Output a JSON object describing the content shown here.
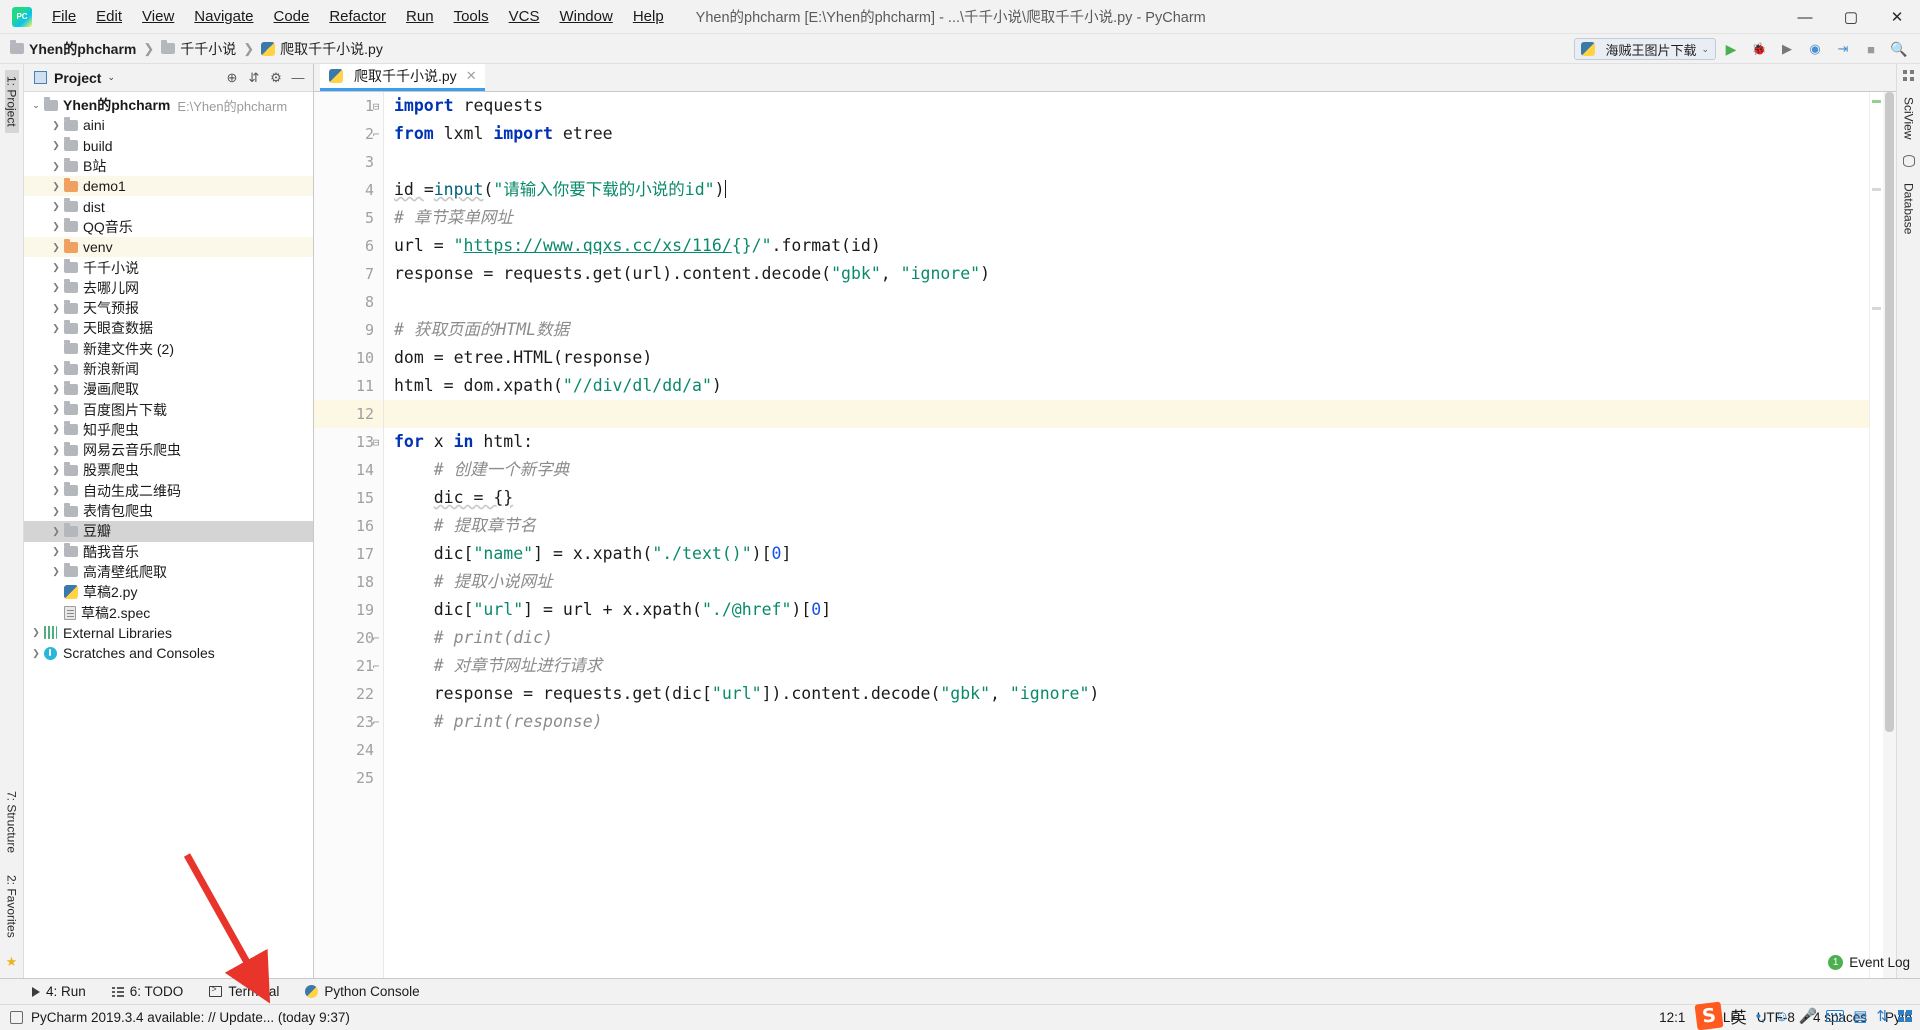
{
  "window": {
    "title": "Yhen的phcharm [E:\\Yhen的phcharm] - ...\\千千小说\\爬取千千小说.py - PyCharm",
    "minimize": "—",
    "maximize": "▢",
    "close": "✕",
    "logo_text": "PC"
  },
  "menu": [
    {
      "label": "File"
    },
    {
      "label": "Edit"
    },
    {
      "label": "View"
    },
    {
      "label": "Navigate"
    },
    {
      "label": "Code"
    },
    {
      "label": "Refactor"
    },
    {
      "label": "Run"
    },
    {
      "label": "Tools"
    },
    {
      "label": "VCS"
    },
    {
      "label": "Window"
    },
    {
      "label": "Help"
    }
  ],
  "breadcrumb": {
    "items": [
      {
        "label": "Yhen的phcharm",
        "icon": "folder-icon",
        "bold": true
      },
      {
        "label": "千千小说",
        "icon": "folder-icon",
        "bold": false
      },
      {
        "label": "爬取千千小说.py",
        "icon": "python-file-icon",
        "bold": false
      }
    ],
    "separator": "❯"
  },
  "toolbar": {
    "run_config": "海贼王图片下载",
    "run_config_caret": "⌄",
    "buttons": [
      {
        "name": "run-button",
        "glyph": "▶",
        "color": "#4caf50"
      },
      {
        "name": "debug-button",
        "glyph": "🐞",
        "color": "#4a8fd0"
      },
      {
        "name": "run-coverage-button",
        "glyph": "▶",
        "color": "#777777"
      },
      {
        "name": "profile-button",
        "glyph": "◉",
        "color": "#4a8fd0"
      },
      {
        "name": "run-with-console-button",
        "glyph": "⇥",
        "color": "#4a8fd0"
      },
      {
        "name": "stop-button",
        "glyph": "■",
        "color": "#9a9a9a"
      },
      {
        "name": "search-everywhere-icon",
        "glyph": "🔍",
        "color": "#555555"
      }
    ]
  },
  "left_rail": {
    "project_label": "1: Project",
    "structure_label": "7: Structure",
    "favorites_label": "2: Favorites"
  },
  "right_rail": {
    "sciview_label": "SciView",
    "database_label": "Database"
  },
  "project_panel": {
    "title": "Project",
    "caret": "⌄",
    "header_icons": [
      {
        "name": "locate-file-icon",
        "glyph": "⊕"
      },
      {
        "name": "collapse-all-icon",
        "glyph": "⇵"
      },
      {
        "name": "settings-gear-icon",
        "glyph": "⚙"
      },
      {
        "name": "hide-panel-icon",
        "glyph": "—"
      }
    ],
    "tree": [
      {
        "label": "Yhen的phcharm",
        "path": "E:\\Yhen的phcharm",
        "icon": "folder-icon",
        "depth": 0,
        "arrow": "open",
        "bold": true,
        "state": "none"
      },
      {
        "label": "aini",
        "icon": "folder-icon",
        "depth": 1,
        "arrow": "closed",
        "state": "none"
      },
      {
        "label": "build",
        "icon": "folder-icon",
        "depth": 1,
        "arrow": "closed",
        "state": "none"
      },
      {
        "label": "B站",
        "icon": "folder-icon",
        "depth": 1,
        "arrow": "closed",
        "state": "none"
      },
      {
        "label": "demo1",
        "icon": "folder-orange-icon",
        "depth": 1,
        "arrow": "closed",
        "state": "highlight"
      },
      {
        "label": "dist",
        "icon": "folder-icon",
        "depth": 1,
        "arrow": "closed",
        "state": "none"
      },
      {
        "label": "QQ音乐",
        "icon": "folder-icon",
        "depth": 1,
        "arrow": "closed",
        "state": "none"
      },
      {
        "label": "venv",
        "icon": "folder-orange-icon",
        "depth": 1,
        "arrow": "closed",
        "state": "highlight"
      },
      {
        "label": "千千小说",
        "icon": "folder-icon",
        "depth": 1,
        "arrow": "closed",
        "state": "none"
      },
      {
        "label": "去哪儿网",
        "icon": "folder-icon",
        "depth": 1,
        "arrow": "closed",
        "state": "none"
      },
      {
        "label": "天气预报",
        "icon": "folder-icon",
        "depth": 1,
        "arrow": "closed",
        "state": "none"
      },
      {
        "label": "天眼查数据",
        "icon": "folder-icon",
        "depth": 1,
        "arrow": "closed",
        "state": "none"
      },
      {
        "label": "新建文件夹 (2)",
        "icon": "folder-icon",
        "depth": 1,
        "arrow": "none",
        "state": "none"
      },
      {
        "label": "新浪新闻",
        "icon": "folder-icon",
        "depth": 1,
        "arrow": "closed",
        "state": "none"
      },
      {
        "label": "漫画爬取",
        "icon": "folder-icon",
        "depth": 1,
        "arrow": "closed",
        "state": "none"
      },
      {
        "label": "百度图片下载",
        "icon": "folder-icon",
        "depth": 1,
        "arrow": "closed",
        "state": "none"
      },
      {
        "label": "知乎爬虫",
        "icon": "folder-icon",
        "depth": 1,
        "arrow": "closed",
        "state": "none"
      },
      {
        "label": "网易云音乐爬虫",
        "icon": "folder-icon",
        "depth": 1,
        "arrow": "closed",
        "state": "none"
      },
      {
        "label": "股票爬虫",
        "icon": "folder-icon",
        "depth": 1,
        "arrow": "closed",
        "state": "none"
      },
      {
        "label": "自动生成二维码",
        "icon": "folder-icon",
        "depth": 1,
        "arrow": "closed",
        "state": "none"
      },
      {
        "label": "表情包爬虫",
        "icon": "folder-icon",
        "depth": 1,
        "arrow": "closed",
        "state": "none"
      },
      {
        "label": "豆瓣",
        "icon": "folder-icon",
        "depth": 1,
        "arrow": "closed",
        "state": "selected"
      },
      {
        "label": "酷我音乐",
        "icon": "folder-icon",
        "depth": 1,
        "arrow": "closed",
        "state": "none"
      },
      {
        "label": "高清壁纸爬取",
        "icon": "folder-icon",
        "depth": 1,
        "arrow": "closed",
        "state": "none"
      },
      {
        "label": "草稿2.py",
        "icon": "python-file-icon",
        "depth": 1,
        "arrow": "none",
        "state": "none"
      },
      {
        "label": "草稿2.spec",
        "icon": "spec-file-icon",
        "depth": 1,
        "arrow": "none",
        "state": "none"
      },
      {
        "label": "External Libraries",
        "icon": "library-icon",
        "depth": 0,
        "arrow": "closed",
        "state": "none"
      },
      {
        "label": "Scratches and Consoles",
        "icon": "scratch-icon",
        "depth": 0,
        "arrow": "closed",
        "state": "none"
      }
    ]
  },
  "editor": {
    "tab": {
      "label": "爬取千千小说.py",
      "icon": "python-file-icon",
      "close": "✕"
    },
    "current_line": 12,
    "lines": [
      {
        "n": 1,
        "fold": "minus",
        "tokens": [
          {
            "t": "import",
            "c": "kw"
          },
          {
            "t": " requests",
            "c": "plain"
          }
        ]
      },
      {
        "n": 2,
        "fold": "end",
        "tokens": [
          {
            "t": "from",
            "c": "kw"
          },
          {
            "t": " lxml ",
            "c": "plain"
          },
          {
            "t": "import",
            "c": "kw"
          },
          {
            "t": " etree",
            "c": "plain"
          }
        ]
      },
      {
        "n": 3,
        "fold": "",
        "tokens": []
      },
      {
        "n": 4,
        "fold": "",
        "tokens": [
          {
            "t": "id ",
            "c": "plain sqg"
          },
          {
            "t": "=",
            "c": "plain"
          },
          {
            "t": "input",
            "c": "fn sqg"
          },
          {
            "t": "(",
            "c": "plain"
          },
          {
            "t": "\"请输入你要下载的小说的id\"",
            "c": "str"
          },
          {
            "t": ")",
            "c": "plain"
          }
        ]
      },
      {
        "n": 5,
        "fold": "",
        "tokens": [
          {
            "t": "# 章节菜单网址",
            "c": "cmt"
          }
        ]
      },
      {
        "n": 6,
        "fold": "",
        "tokens": [
          {
            "t": "url = ",
            "c": "plain"
          },
          {
            "t": "\"",
            "c": "str"
          },
          {
            "t": "https://www.qqxs.cc/xs/116/",
            "c": "lnk"
          },
          {
            "t": "{}/",
            "c": "str"
          },
          {
            "t": "\"",
            "c": "str"
          },
          {
            "t": ".format(id)",
            "c": "plain"
          }
        ]
      },
      {
        "n": 7,
        "fold": "",
        "tokens": [
          {
            "t": "response = requests.get(url).content.decode(",
            "c": "plain"
          },
          {
            "t": "\"gbk\"",
            "c": "str"
          },
          {
            "t": ", ",
            "c": "plain"
          },
          {
            "t": "\"ignore\"",
            "c": "str"
          },
          {
            "t": ")",
            "c": "plain"
          }
        ]
      },
      {
        "n": 8,
        "fold": "",
        "tokens": []
      },
      {
        "n": 9,
        "fold": "",
        "tokens": [
          {
            "t": "# 获取页面的HTML数据",
            "c": "cmt"
          }
        ]
      },
      {
        "n": 10,
        "fold": "",
        "tokens": [
          {
            "t": "dom = etree.HTML(response)",
            "c": "plain"
          }
        ]
      },
      {
        "n": 11,
        "fold": "",
        "tokens": [
          {
            "t": "html = dom.xpath(",
            "c": "plain"
          },
          {
            "t": "\"//div/dl/dd/a\"",
            "c": "str"
          },
          {
            "t": ")",
            "c": "plain"
          }
        ]
      },
      {
        "n": 12,
        "fold": "",
        "tokens": []
      },
      {
        "n": 13,
        "fold": "minus",
        "tokens": [
          {
            "t": "for",
            "c": "kw"
          },
          {
            "t": " x ",
            "c": "plain"
          },
          {
            "t": "in",
            "c": "kw"
          },
          {
            "t": " html:",
            "c": "plain"
          }
        ]
      },
      {
        "n": 14,
        "fold": "",
        "tokens": [
          {
            "t": "    # 创建一个新字典",
            "c": "cmt"
          }
        ]
      },
      {
        "n": 15,
        "fold": "",
        "tokens": [
          {
            "t": "    ",
            "c": "plain"
          },
          {
            "t": "dic = {}",
            "c": "plain sqg"
          }
        ]
      },
      {
        "n": 16,
        "fold": "",
        "tokens": [
          {
            "t": "    # 提取章节名",
            "c": "cmt"
          }
        ]
      },
      {
        "n": 17,
        "fold": "",
        "tokens": [
          {
            "t": "    dic[",
            "c": "plain"
          },
          {
            "t": "\"name\"",
            "c": "str"
          },
          {
            "t": "] = x.xpath(",
            "c": "plain"
          },
          {
            "t": "\"./text()\"",
            "c": "str"
          },
          {
            "t": ")[",
            "c": "plain"
          },
          {
            "t": "0",
            "c": "num"
          },
          {
            "t": "]",
            "c": "plain"
          }
        ]
      },
      {
        "n": 18,
        "fold": "",
        "tokens": [
          {
            "t": "    # 提取小说网址",
            "c": "cmt"
          }
        ]
      },
      {
        "n": 19,
        "fold": "",
        "tokens": [
          {
            "t": "    dic[",
            "c": "plain"
          },
          {
            "t": "\"url\"",
            "c": "str"
          },
          {
            "t": "] = url + x.xpath(",
            "c": "plain"
          },
          {
            "t": "\"./@href\"",
            "c": "str"
          },
          {
            "t": ")[",
            "c": "plain"
          },
          {
            "t": "0",
            "c": "num"
          },
          {
            "t": "]",
            "c": "plain"
          }
        ]
      },
      {
        "n": 20,
        "fold": "end",
        "tokens": [
          {
            "t": "    # print(dic)",
            "c": "cmt"
          }
        ]
      },
      {
        "n": 21,
        "fold": "end2",
        "tokens": [
          {
            "t": "    # 对章节网址进行请求",
            "c": "cmt"
          }
        ]
      },
      {
        "n": 22,
        "fold": "",
        "tokens": [
          {
            "t": "    response = requests.get(dic[",
            "c": "plain"
          },
          {
            "t": "\"url\"",
            "c": "str"
          },
          {
            "t": "]).content.decode(",
            "c": "plain"
          },
          {
            "t": "\"gbk\"",
            "c": "str"
          },
          {
            "t": ", ",
            "c": "plain"
          },
          {
            "t": "\"ignore\"",
            "c": "str"
          },
          {
            "t": ")",
            "c": "plain"
          }
        ]
      },
      {
        "n": 23,
        "fold": "end",
        "tokens": [
          {
            "t": "    # print(response)",
            "c": "cmt"
          }
        ]
      },
      {
        "n": 24,
        "fold": "",
        "tokens": []
      },
      {
        "n": 25,
        "fold": "",
        "tokens": []
      }
    ]
  },
  "bottom_tools": [
    {
      "label": "4: Run",
      "mnemonic": "4",
      "icon": "run-triangle-icon"
    },
    {
      "label": "6: TODO",
      "mnemonic": "6",
      "icon": "todo-list-icon"
    },
    {
      "label": "Terminal",
      "mnemonic": "",
      "icon": "terminal-icon"
    },
    {
      "label": "Python Console",
      "mnemonic": "",
      "icon": "python-console-icon"
    }
  ],
  "status": {
    "message": "PyCharm 2019.3.4 available: // Update... (today 9:37)",
    "event_log": "Event Log",
    "event_badge": "1",
    "caret_position": "12:1",
    "line_separator": "CRLF",
    "encoding": "UTF-8",
    "indent": "4 spaces",
    "interpreter": "Pyth",
    "ime_sogou": "S",
    "ime_lang": "英"
  },
  "colors": {
    "accent_blue": "#3d9bf0",
    "folder_orange": "#f0a060",
    "string_green": "#0a8a6a",
    "keyword_blue": "#0033b3",
    "caret_line": "#fdf8e3",
    "arrow_red": "#e8342a"
  }
}
